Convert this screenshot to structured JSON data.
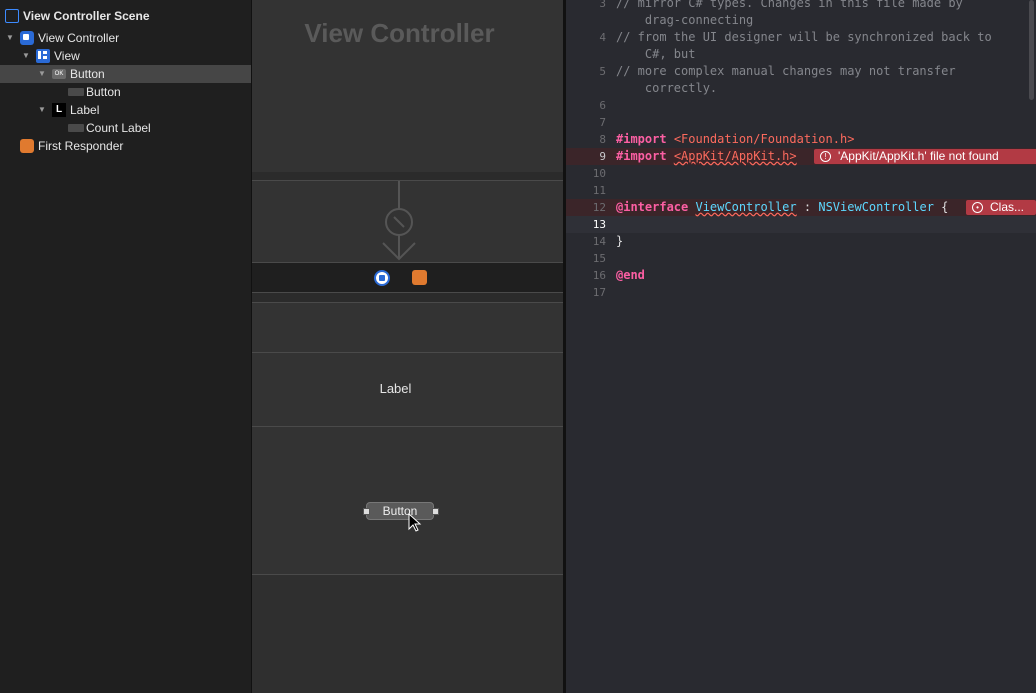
{
  "outline": {
    "scene": "View Controller Scene",
    "items": [
      {
        "label": "View Controller"
      },
      {
        "label": "View"
      },
      {
        "label": "Button",
        "badge": "OK"
      },
      {
        "label": "Button"
      },
      {
        "label": "Label",
        "badge": "L"
      },
      {
        "label": "Count Label"
      },
      {
        "label": "First Responder"
      }
    ]
  },
  "canvas": {
    "title": "View Controller",
    "label_text": "Label",
    "button_text": "Button"
  },
  "editor": {
    "lines": [
      {
        "n": "3",
        "text": "// mirror C# types. Changes in this file made by"
      },
      {
        "n": "",
        "text": "    drag-connecting"
      },
      {
        "n": "4",
        "text": "// from the UI designer will be synchronized back to"
      },
      {
        "n": "",
        "text": "    C#, but"
      },
      {
        "n": "5",
        "text": "// more complex manual changes may not transfer"
      },
      {
        "n": "",
        "text": "    correctly."
      },
      {
        "n": "6",
        "text": ""
      },
      {
        "n": "7",
        "text": ""
      },
      {
        "n": "8",
        "kw": "#import",
        "str": "<Foundation/Foundation.h>"
      },
      {
        "n": "9",
        "kw": "#import",
        "str": "<AppKit/AppKit.h>"
      },
      {
        "n": "10",
        "text": ""
      },
      {
        "n": "11",
        "text": ""
      },
      {
        "n": "12",
        "kw": "@interface",
        "typ": "ViewController",
        "sep": ":",
        "typ2": "NSViewController",
        "tail": "{"
      },
      {
        "n": "13",
        "text": ""
      },
      {
        "n": "14",
        "text": "}"
      },
      {
        "n": "15",
        "text": ""
      },
      {
        "n": "16",
        "kw": "@end"
      },
      {
        "n": "17",
        "text": ""
      }
    ],
    "errors": [
      "'AppKit/AppKit.h' file not found",
      "Clas..."
    ]
  },
  "colors": {
    "error_badge": "#b23a44",
    "keyword": "#fc5fa3",
    "string": "#fc6a5d",
    "type": "#5dd8ff"
  }
}
